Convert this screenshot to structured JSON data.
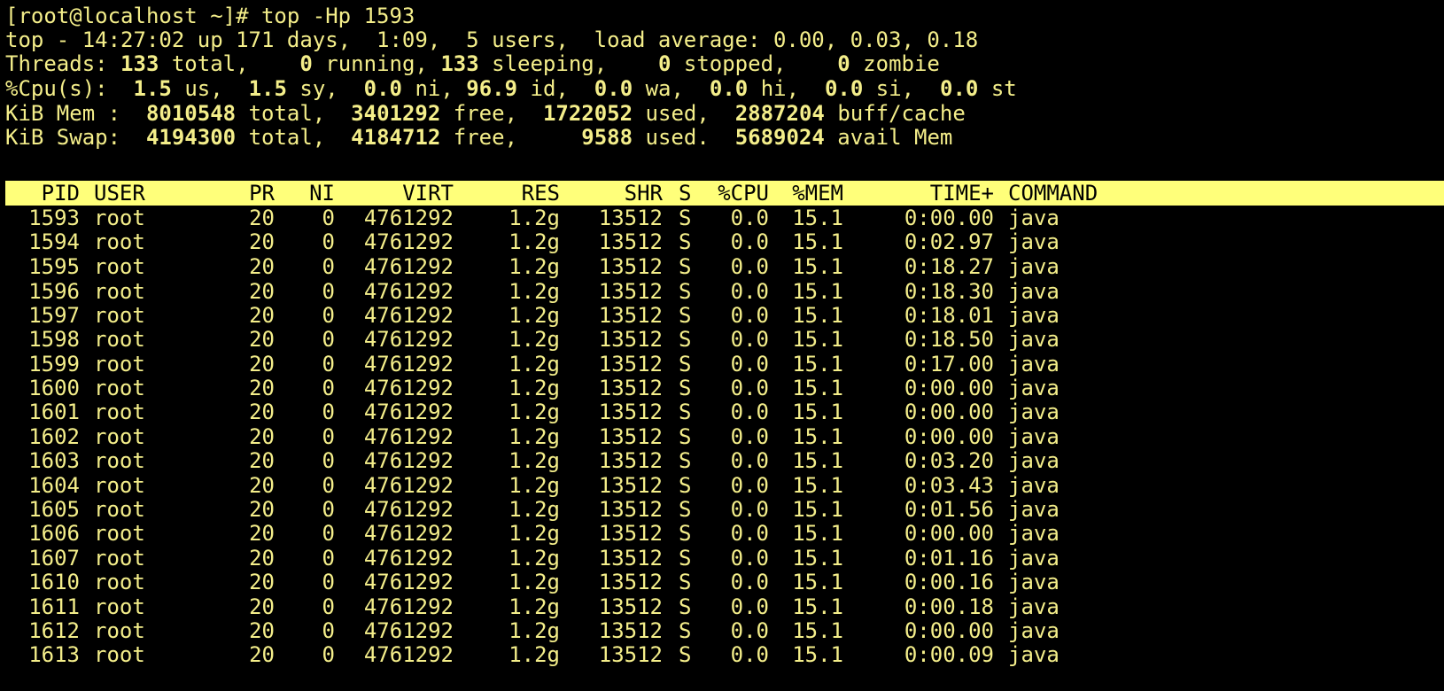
{
  "terminal": {
    "prompt": "[root@localhost ~]# ",
    "command": "top -Hp 1593",
    "top_line": "top - 14:27:02 up 171 days,  1:09,  5 users,  load average: 0.00, 0.03, 0.18",
    "threads": {
      "label": "Threads:",
      "total": "133",
      "total_label": "total,",
      "running": "0",
      "running_label": "running,",
      "sleeping": "133",
      "sleeping_label": "sleeping,",
      "stopped": "0",
      "stopped_label": "stopped,",
      "zombie": "0",
      "zombie_label": "zombie"
    },
    "cpu": {
      "label": "%Cpu(s):",
      "us": "1.5",
      "us_label": "us,",
      "sy": "1.5",
      "sy_label": "sy,",
      "ni": "0.0",
      "ni_label": "ni,",
      "id": "96.9",
      "id_label": "id,",
      "wa": "0.0",
      "wa_label": "wa,",
      "hi": "0.0",
      "hi_label": "hi,",
      "si": "0.0",
      "si_label": "si,",
      "st": "0.0",
      "st_label": "st"
    },
    "mem": {
      "label": "KiB Mem :",
      "total": "8010548",
      "total_label": "total,",
      "free": "3401292",
      "free_label": "free,",
      "used": "1722052",
      "used_label": "used,",
      "buff": "2887204",
      "buff_label": "buff/cache"
    },
    "swap": {
      "label": "KiB Swap:",
      "total": "4194300",
      "total_label": "total,",
      "free": "4184712",
      "free_label": "free,",
      "used": "9588",
      "used_label": "used.",
      "avail": "5689024",
      "avail_label": "avail Mem"
    },
    "columns": [
      "PID",
      "USER",
      "PR",
      "NI",
      "VIRT",
      "RES",
      "SHR",
      "S",
      "%CPU",
      "%MEM",
      "TIME+",
      "COMMAND"
    ],
    "rows": [
      [
        "1593",
        "root",
        "20",
        "0",
        "4761292",
        "1.2g",
        "13512",
        "S",
        "0.0",
        "15.1",
        "0:00.00",
        "java"
      ],
      [
        "1594",
        "root",
        "20",
        "0",
        "4761292",
        "1.2g",
        "13512",
        "S",
        "0.0",
        "15.1",
        "0:02.97",
        "java"
      ],
      [
        "1595",
        "root",
        "20",
        "0",
        "4761292",
        "1.2g",
        "13512",
        "S",
        "0.0",
        "15.1",
        "0:18.27",
        "java"
      ],
      [
        "1596",
        "root",
        "20",
        "0",
        "4761292",
        "1.2g",
        "13512",
        "S",
        "0.0",
        "15.1",
        "0:18.30",
        "java"
      ],
      [
        "1597",
        "root",
        "20",
        "0",
        "4761292",
        "1.2g",
        "13512",
        "S",
        "0.0",
        "15.1",
        "0:18.01",
        "java"
      ],
      [
        "1598",
        "root",
        "20",
        "0",
        "4761292",
        "1.2g",
        "13512",
        "S",
        "0.0",
        "15.1",
        "0:18.50",
        "java"
      ],
      [
        "1599",
        "root",
        "20",
        "0",
        "4761292",
        "1.2g",
        "13512",
        "S",
        "0.0",
        "15.1",
        "0:17.00",
        "java"
      ],
      [
        "1600",
        "root",
        "20",
        "0",
        "4761292",
        "1.2g",
        "13512",
        "S",
        "0.0",
        "15.1",
        "0:00.00",
        "java"
      ],
      [
        "1601",
        "root",
        "20",
        "0",
        "4761292",
        "1.2g",
        "13512",
        "S",
        "0.0",
        "15.1",
        "0:00.00",
        "java"
      ],
      [
        "1602",
        "root",
        "20",
        "0",
        "4761292",
        "1.2g",
        "13512",
        "S",
        "0.0",
        "15.1",
        "0:00.00",
        "java"
      ],
      [
        "1603",
        "root",
        "20",
        "0",
        "4761292",
        "1.2g",
        "13512",
        "S",
        "0.0",
        "15.1",
        "0:03.20",
        "java"
      ],
      [
        "1604",
        "root",
        "20",
        "0",
        "4761292",
        "1.2g",
        "13512",
        "S",
        "0.0",
        "15.1",
        "0:03.43",
        "java"
      ],
      [
        "1605",
        "root",
        "20",
        "0",
        "4761292",
        "1.2g",
        "13512",
        "S",
        "0.0",
        "15.1",
        "0:01.56",
        "java"
      ],
      [
        "1606",
        "root",
        "20",
        "0",
        "4761292",
        "1.2g",
        "13512",
        "S",
        "0.0",
        "15.1",
        "0:00.00",
        "java"
      ],
      [
        "1607",
        "root",
        "20",
        "0",
        "4761292",
        "1.2g",
        "13512",
        "S",
        "0.0",
        "15.1",
        "0:01.16",
        "java"
      ],
      [
        "1610",
        "root",
        "20",
        "0",
        "4761292",
        "1.2g",
        "13512",
        "S",
        "0.0",
        "15.1",
        "0:00.16",
        "java"
      ],
      [
        "1611",
        "root",
        "20",
        "0",
        "4761292",
        "1.2g",
        "13512",
        "S",
        "0.0",
        "15.1",
        "0:00.18",
        "java"
      ],
      [
        "1612",
        "root",
        "20",
        "0",
        "4761292",
        "1.2g",
        "13512",
        "S",
        "0.0",
        "15.1",
        "0:00.00",
        "java"
      ],
      [
        "1613",
        "root",
        "20",
        "0",
        "4761292",
        "1.2g",
        "13512",
        "S",
        "0.0",
        "15.1",
        "0:00.09",
        "java"
      ]
    ]
  },
  "colors": {
    "background": "#000000",
    "text": "#f4ee8a",
    "header_bar": "#ffff7a",
    "header_text": "#000000"
  }
}
